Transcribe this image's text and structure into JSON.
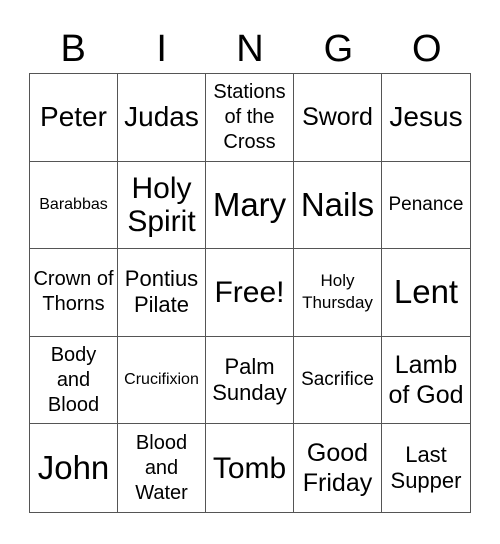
{
  "header": [
    "B",
    "I",
    "N",
    "G",
    "O"
  ],
  "cells": [
    "Peter",
    "Judas",
    "Stations of the Cross",
    "Sword",
    "Jesus",
    "Barabbas",
    "Holy Spirit",
    "Mary",
    "Nails",
    "Penance",
    "Crown of Thorns",
    "Pontius Pilate",
    "Free!",
    "Holy Thursday",
    "Lent",
    "Body and Blood",
    "Crucifixion",
    "Palm Sunday",
    "Sacrifice",
    "Lamb of God",
    "John",
    "Blood and Water",
    "Tomb",
    "Good Friday",
    "Last Supper"
  ]
}
